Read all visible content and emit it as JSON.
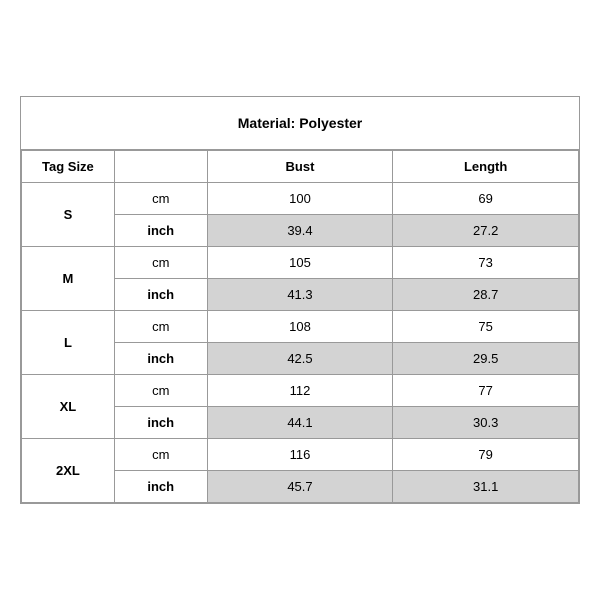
{
  "title": "Material: Polyester",
  "headers": {
    "tag_size": "Tag Size",
    "bust": "Bust",
    "length": "Length"
  },
  "rows": [
    {
      "size": "S",
      "cm": {
        "bust": "100",
        "length": "69"
      },
      "inch": {
        "bust": "39.4",
        "length": "27.2"
      }
    },
    {
      "size": "M",
      "cm": {
        "bust": "105",
        "length": "73"
      },
      "inch": {
        "bust": "41.3",
        "length": "28.7"
      }
    },
    {
      "size": "L",
      "cm": {
        "bust": "108",
        "length": "75"
      },
      "inch": {
        "bust": "42.5",
        "length": "29.5"
      }
    },
    {
      "size": "XL",
      "cm": {
        "bust": "112",
        "length": "77"
      },
      "inch": {
        "bust": "44.1",
        "length": "30.3"
      }
    },
    {
      "size": "2XL",
      "cm": {
        "bust": "116",
        "length": "79"
      },
      "inch": {
        "bust": "45.7",
        "length": "31.1"
      }
    }
  ],
  "unit_labels": {
    "cm": "cm",
    "inch": "inch"
  }
}
